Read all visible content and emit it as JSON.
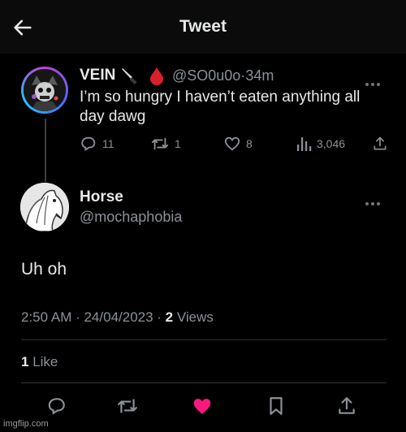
{
  "header": {
    "title": "Tweet"
  },
  "parent_tweet": {
    "name": "VEIN",
    "emojis": [
      "knife-icon",
      "blood-drop-icon"
    ],
    "handle_time": "@SO0u0o·34m",
    "text": "I’m so hungry I haven’t eaten anything all day dawg",
    "replies": "11",
    "retweets": "1",
    "likes": "8",
    "views": "3,046"
  },
  "main_tweet": {
    "name": "Horse",
    "handle": "@mochaphobia",
    "text": "Uh oh",
    "timestamp": "2:50 AM · 24/04/2023 · ",
    "views_count": "2",
    "views_label": " Views",
    "like_count": "1",
    "like_label": " Like"
  },
  "actions": [
    "reply-icon",
    "retweet-icon",
    "like-icon",
    "bookmark-icon",
    "share-icon"
  ],
  "colors": {
    "like_active": "#f91880",
    "muted": "#8b9198",
    "text": "#e7e9ea"
  },
  "watermark": "imgflip.com"
}
